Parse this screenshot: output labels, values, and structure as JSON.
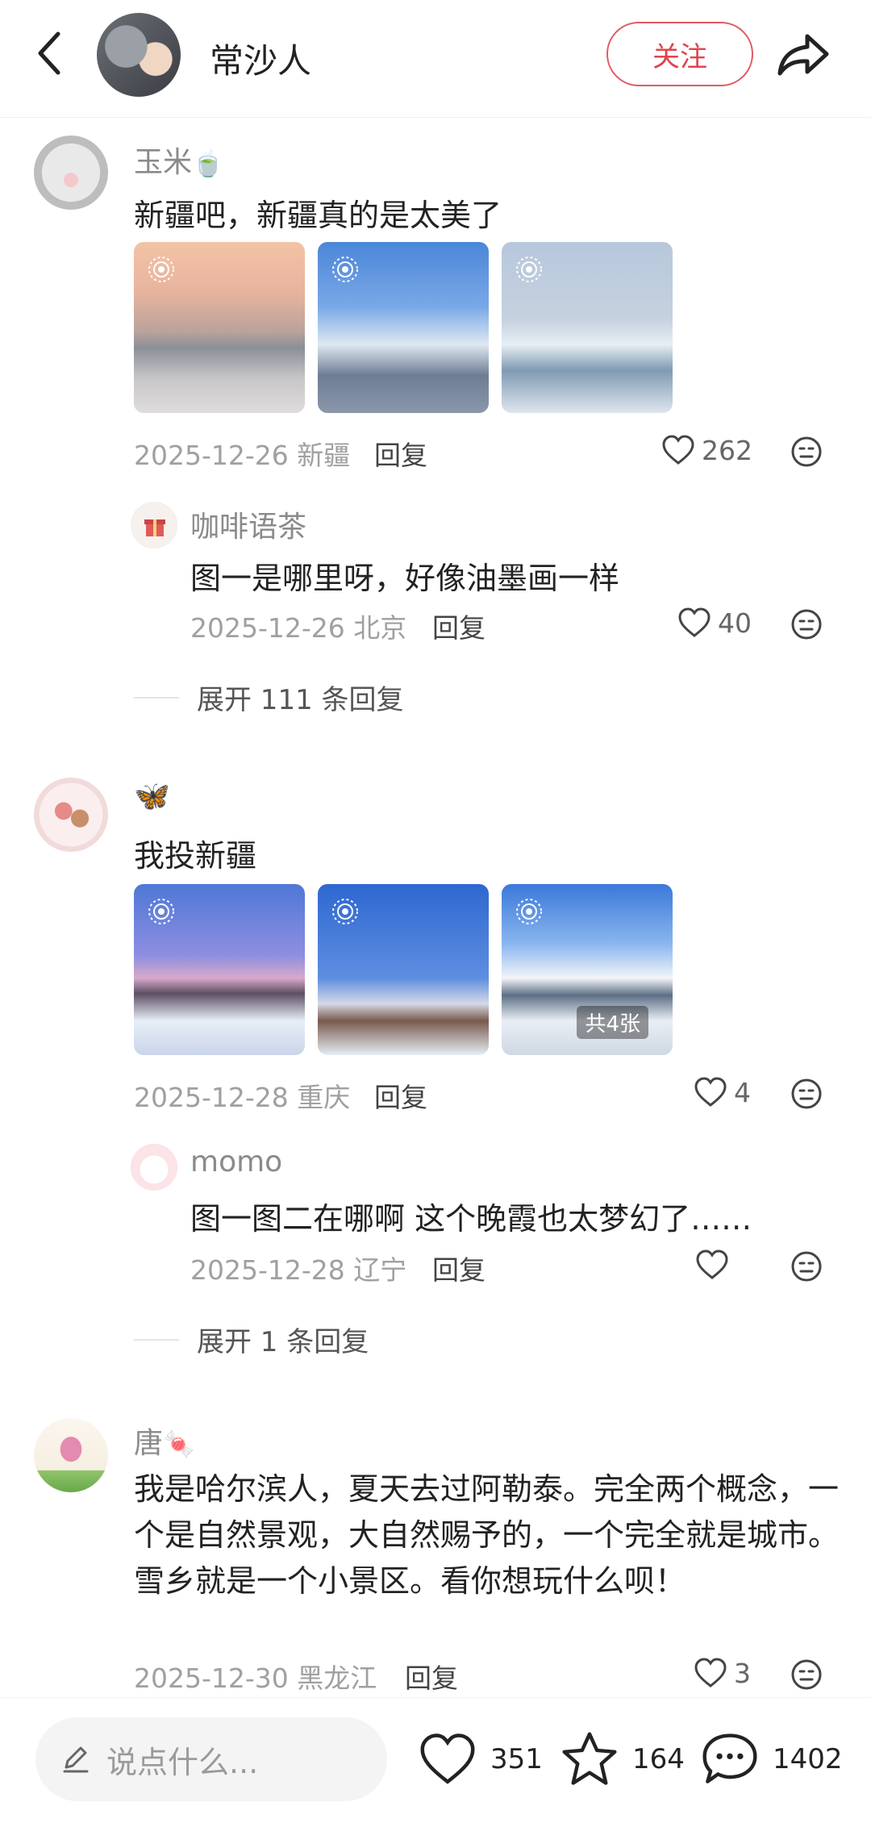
{
  "header": {
    "author_name": "常沙人",
    "follow_label": "关注"
  },
  "comments": [
    {
      "username": "玉米",
      "username_emoji": "🍵",
      "text": "新疆吧，新疆真的是太美了",
      "date_location": "2025-12-26 新疆",
      "reply_label": "回复",
      "likes": "262",
      "replies": [
        {
          "username": "咖啡语茶",
          "text": "图一是哪里呀，好像油墨画一样",
          "date_location": "2025-12-26 北京",
          "reply_label": "回复",
          "likes": "40"
        }
      ],
      "expand_label": "展开 111 条回复"
    },
    {
      "username": "🦋",
      "text": "我投新疆",
      "date_location": "2025-12-28 重庆",
      "reply_label": "回复",
      "likes": "4",
      "image_count_badge": "共4张",
      "replies": [
        {
          "username": "momo",
          "text": "图一图二在哪啊 这个晚霞也太梦幻了……",
          "date_location": "2025-12-28 辽宁",
          "reply_label": "回复",
          "likes": ""
        }
      ],
      "expand_label": "展开 1 条回复"
    },
    {
      "username": "唐",
      "username_emoji": "🍬",
      "text": "我是哈尔滨人，夏天去过阿勒泰。完全两个概念，一个是自然景观，大自然赐予的，一个完全就是城市。雪乡就是一个小景区。看你想玩什么呗！",
      "date_location": "2025-12-30 黑龙江",
      "reply_label": "回复",
      "likes": "3"
    }
  ],
  "bottom_bar": {
    "input_placeholder": "说点什么...",
    "likes": "351",
    "favorites": "164",
    "comments": "1402"
  },
  "colors": {
    "accent": "#e0444f",
    "muted_text": "#a0a0a0"
  },
  "icons": [
    "back-arrow-icon",
    "share-icon",
    "heart-icon",
    "dislike-face-icon",
    "live-photo-icon",
    "pencil-icon",
    "star-icon",
    "comment-bubble-icon"
  ]
}
